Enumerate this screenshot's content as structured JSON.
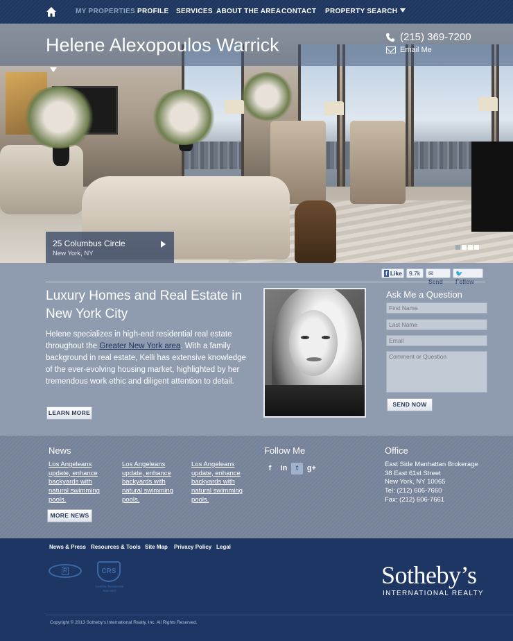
{
  "nav": {
    "items": [
      {
        "label": "MY PROPERTIES",
        "active": true
      },
      {
        "label": "PROFILE"
      },
      {
        "label": "SERVICES"
      },
      {
        "label": "ABOUT THE AREA"
      },
      {
        "label": "CONTACT"
      },
      {
        "label": "PROPERTY SEARCH"
      }
    ]
  },
  "hero": {
    "agent_name": "Helene Alexopoulos Warrick",
    "phone": "(215) 369-7200",
    "email_label": "Email Me",
    "listing": {
      "address": "25 Columbus Circle",
      "city": "New York, NY"
    },
    "slides": 4,
    "active_slide": 1
  },
  "social": {
    "like": "Like",
    "like_count": "9.7k",
    "send": "Send",
    "follow": "Follow"
  },
  "main": {
    "headline": "Luxury Homes and Real Estate in New York City",
    "intro_before": "Helene specializes in high-end residential real estate throughout the ",
    "intro_link": "Greater New York area",
    "intro_after": ". With a family background in real estate, Kelli has extensive knowledge of the ever-evolving housing market, highlighted by her tremendous work ethic and diligent attention to detail.",
    "learn_more": "LEARN MORE"
  },
  "ask": {
    "title": "Ask Me a Question",
    "first_name": "First Name",
    "last_name": "Last Name",
    "email": "Email",
    "comment": "Comment or Question",
    "send_now": "SEND NOW"
  },
  "footer": {
    "news_title": "News",
    "news_items": [
      "Los Angeleans update, enhance backyards with natural swimming pools.",
      "Los Angeleans update, enhance backyards with natural swimming pools.",
      "Los Angeleans update, enhance backyards with natural swimming pools."
    ],
    "more_news": "MORE NEWS",
    "follow_title": "Follow Me",
    "office_title": "Office",
    "office_lines": [
      "East Side Manhattan Brokerage",
      "38 East 61st Street",
      "New York, NY  10065",
      "Tel: (212) 606-7660",
      "Fax: (212) 606-7661"
    ]
  },
  "bottom": {
    "links": [
      "News & Press",
      "Resources & Tools",
      "Site Map",
      "Privacy Policy",
      "Legal"
    ],
    "brand": "Sotheby’s",
    "brand_sub": "INTERNATIONAL REALTY",
    "crs": "CRS",
    "crs_sub": "Certified Residential Specialist",
    "copyright": "Copyright © 2013 Sotheby's International Realty, Inc. All Rights Reserved."
  },
  "colors": {
    "nav_bg": "#213a63",
    "main_bg": "#8f9cb0",
    "footer_bg": "#7b879c",
    "bottom_bg": "#1d3663",
    "link": "#22335a"
  }
}
